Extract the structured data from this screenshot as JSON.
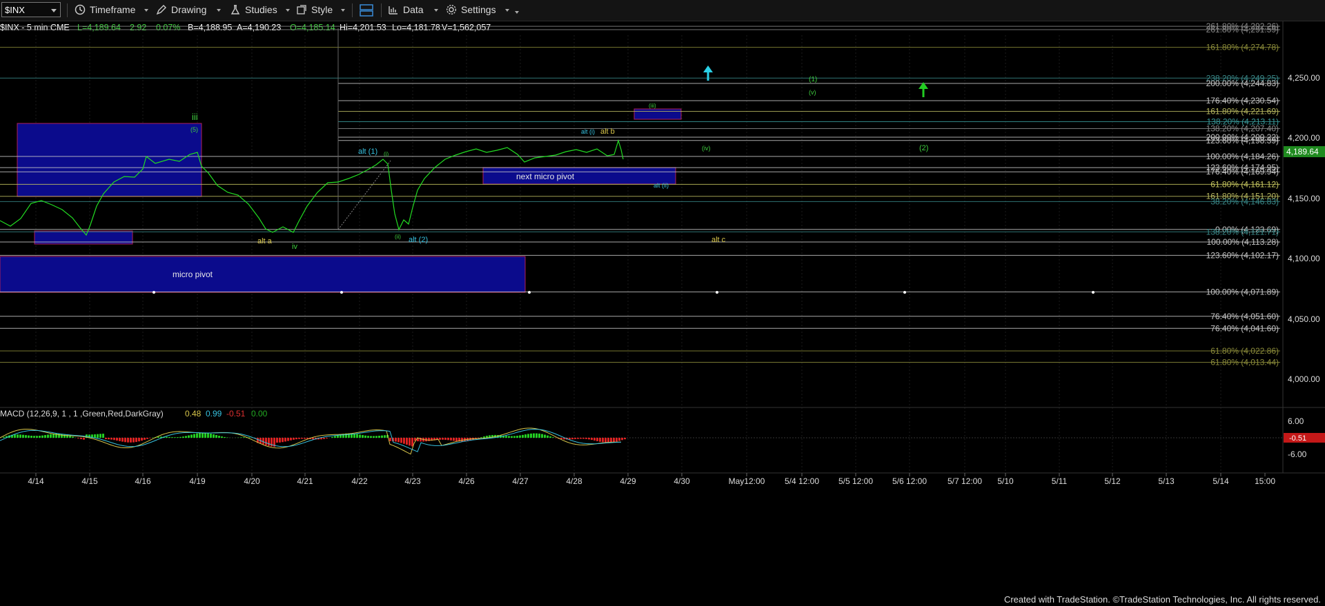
{
  "toolbar": {
    "symbol": "$INX",
    "timeframe": "Timeframe",
    "drawing": "Drawing",
    "studies": "Studies",
    "style": "Style",
    "data": "Data",
    "settings": "Settings"
  },
  "header": {
    "symbol": "$INX - 5 min  CME",
    "last": "L=4,189.64",
    "change": "2.92",
    "pct": "0.07%",
    "bid": "B=4,188.95",
    "ask": "A=4,190.23",
    "open": "O=4,185.14",
    "high": "Hi=4,201.53",
    "low": "Lo=4,181.78",
    "volume": "V=1,562,057"
  },
  "price_axis": {
    "ticks": [
      "4,250.00",
      "4,200.00",
      "4,150.00",
      "4,100.00",
      "4,050.00",
      "4,000.00"
    ],
    "last_price": "4,189.64",
    "last_price_color": "#2aa32a"
  },
  "fib_levels": [
    {
      "label": "261.80% (4,292.26)",
      "value": 4292.26,
      "color": "#8a8a8a"
    },
    {
      "label": "261.80% (4,291.59)",
      "value": 4289.5,
      "color": "#8a8a8a"
    },
    {
      "label": "161.80% (4,274.78)",
      "value": 4274.78,
      "color": "#8c8c3a"
    },
    {
      "label": "238.20% (4,249.25)",
      "value": 4249.25,
      "color": "#3a8a8a"
    },
    {
      "label": "200.00% (4,244.83)",
      "value": 4244.83,
      "color": "#c8c8c8"
    },
    {
      "label": "176.40% (4,230.54)",
      "value": 4230.54,
      "color": "#c8c8c8"
    },
    {
      "label": "161.80% (4,221.69)",
      "value": 4221.69,
      "color": "#b8b860"
    },
    {
      "label": "138.20% (4,213.11)",
      "value": 4213.11,
      "color": "#3a9a9a"
    },
    {
      "label": "138.20% (4,207.40)",
      "value": 4207.4,
      "color": "#8a8a8a"
    },
    {
      "label": "200.00% (4,200.22)",
      "value": 4200.22,
      "color": "#c8c8c8"
    },
    {
      "label": "123.60% (4,198.39)",
      "value": 4197.5,
      "color": "#c8c8c8"
    },
    {
      "label": "100.00% (4,184.26)",
      "value": 4184.26,
      "color": "#c8c8c8"
    },
    {
      "label": "123.60% (4,174.95)",
      "value": 4174.95,
      "color": "#c8c8c8"
    },
    {
      "label": "176.40% (4,169.94)",
      "value": 4171.5,
      "color": "#c8c8c8"
    },
    {
      "label": "61.80% (4,161.12)",
      "value": 4161.12,
      "color": "#c8c860"
    },
    {
      "label": "161.80% (4,151.20)",
      "value": 4151.2,
      "color": "#b8b860"
    },
    {
      "label": "38.20% (4,146.83)",
      "value": 4146.83,
      "color": "#3a8a8a"
    },
    {
      "label": "0.00% (4,123.69)",
      "value": 4123.69,
      "color": "#c8c8c8"
    },
    {
      "label": "138.20% (4,121.71)",
      "value": 4121.71,
      "color": "#3a8a8a"
    },
    {
      "label": "100.00% (4,113.28)",
      "value": 4113.28,
      "color": "#c8c8c8"
    },
    {
      "label": "123.60% (4,102.17)",
      "value": 4102.17,
      "color": "#c8c8c8"
    },
    {
      "label": "100.00% (4,071.89)",
      "value": 4071.89,
      "color": "#c8c8c8"
    },
    {
      "label": "76.40% (4,051.60)",
      "value": 4051.6,
      "color": "#c8c8c8"
    },
    {
      "label": "76.40% (4,041.60)",
      "value": 4041.6,
      "color": "#c8c8c8"
    },
    {
      "label": "61.80% (4,022.86)",
      "value": 4022.86,
      "color": "#8c8c3a"
    },
    {
      "label": "61.80% (4,013.44)",
      "value": 4013.44,
      "color": "#8c8c3a"
    }
  ],
  "annotations": {
    "micro_pivot": "micro pivot",
    "next_micro_pivot": "next micro pivot",
    "wave_iii": "iii",
    "wave_5": "(5)",
    "alt_a": "alt a",
    "wave_iv": "iv",
    "alt_1": "alt (1)",
    "wave_i": "(i)",
    "wave_ii": "(ii)",
    "alt_2": "alt (2)",
    "alt_i": "alt (i)",
    "alt_b": "alt b",
    "wave_iii_paren": "(iii)",
    "wave_iv_paren": "(iv)",
    "wave_v": "(v)",
    "wave_1": "(1)",
    "wave_2": "(2)",
    "alt_ii": "alt (ii)",
    "alt_c": "alt c"
  },
  "macd": {
    "label": "MACD (12,26,9, 1 , 1 ,Green,Red,DarkGray)",
    "v1": "0.48",
    "v2": "0.99",
    "v3": "-0.51",
    "v4": "0.00",
    "ticks": [
      "6.00",
      "-6.00"
    ],
    "current": "-0.51"
  },
  "time_axis": [
    "4/14",
    "4/15",
    "4/16",
    "4/19",
    "4/20",
    "4/21",
    "4/22",
    "4/23",
    "4/26",
    "4/27",
    "4/28",
    "4/29",
    "4/30",
    "May12:00",
    "5/4 12:00",
    "5/5 12:00",
    "5/6 12:00",
    "5/7 12:00",
    "5/10",
    "5/11",
    "5/12",
    "5/13",
    "5/14",
    "15:00"
  ],
  "footer": "Created with TradeStation. ©TradeStation Technologies, Inc. All rights reserved.",
  "colors": {
    "price_line": "#22dd22",
    "pivot_box": "#0b0b8c",
    "pivot_border": "#b0205a",
    "annotation_yellow": "#d8c64a",
    "annotation_cyan": "#36c2e0",
    "annotation_green": "#3fcf3f",
    "arrow_cyan": "#2ad0e6",
    "arrow_green": "#22cc22"
  }
}
